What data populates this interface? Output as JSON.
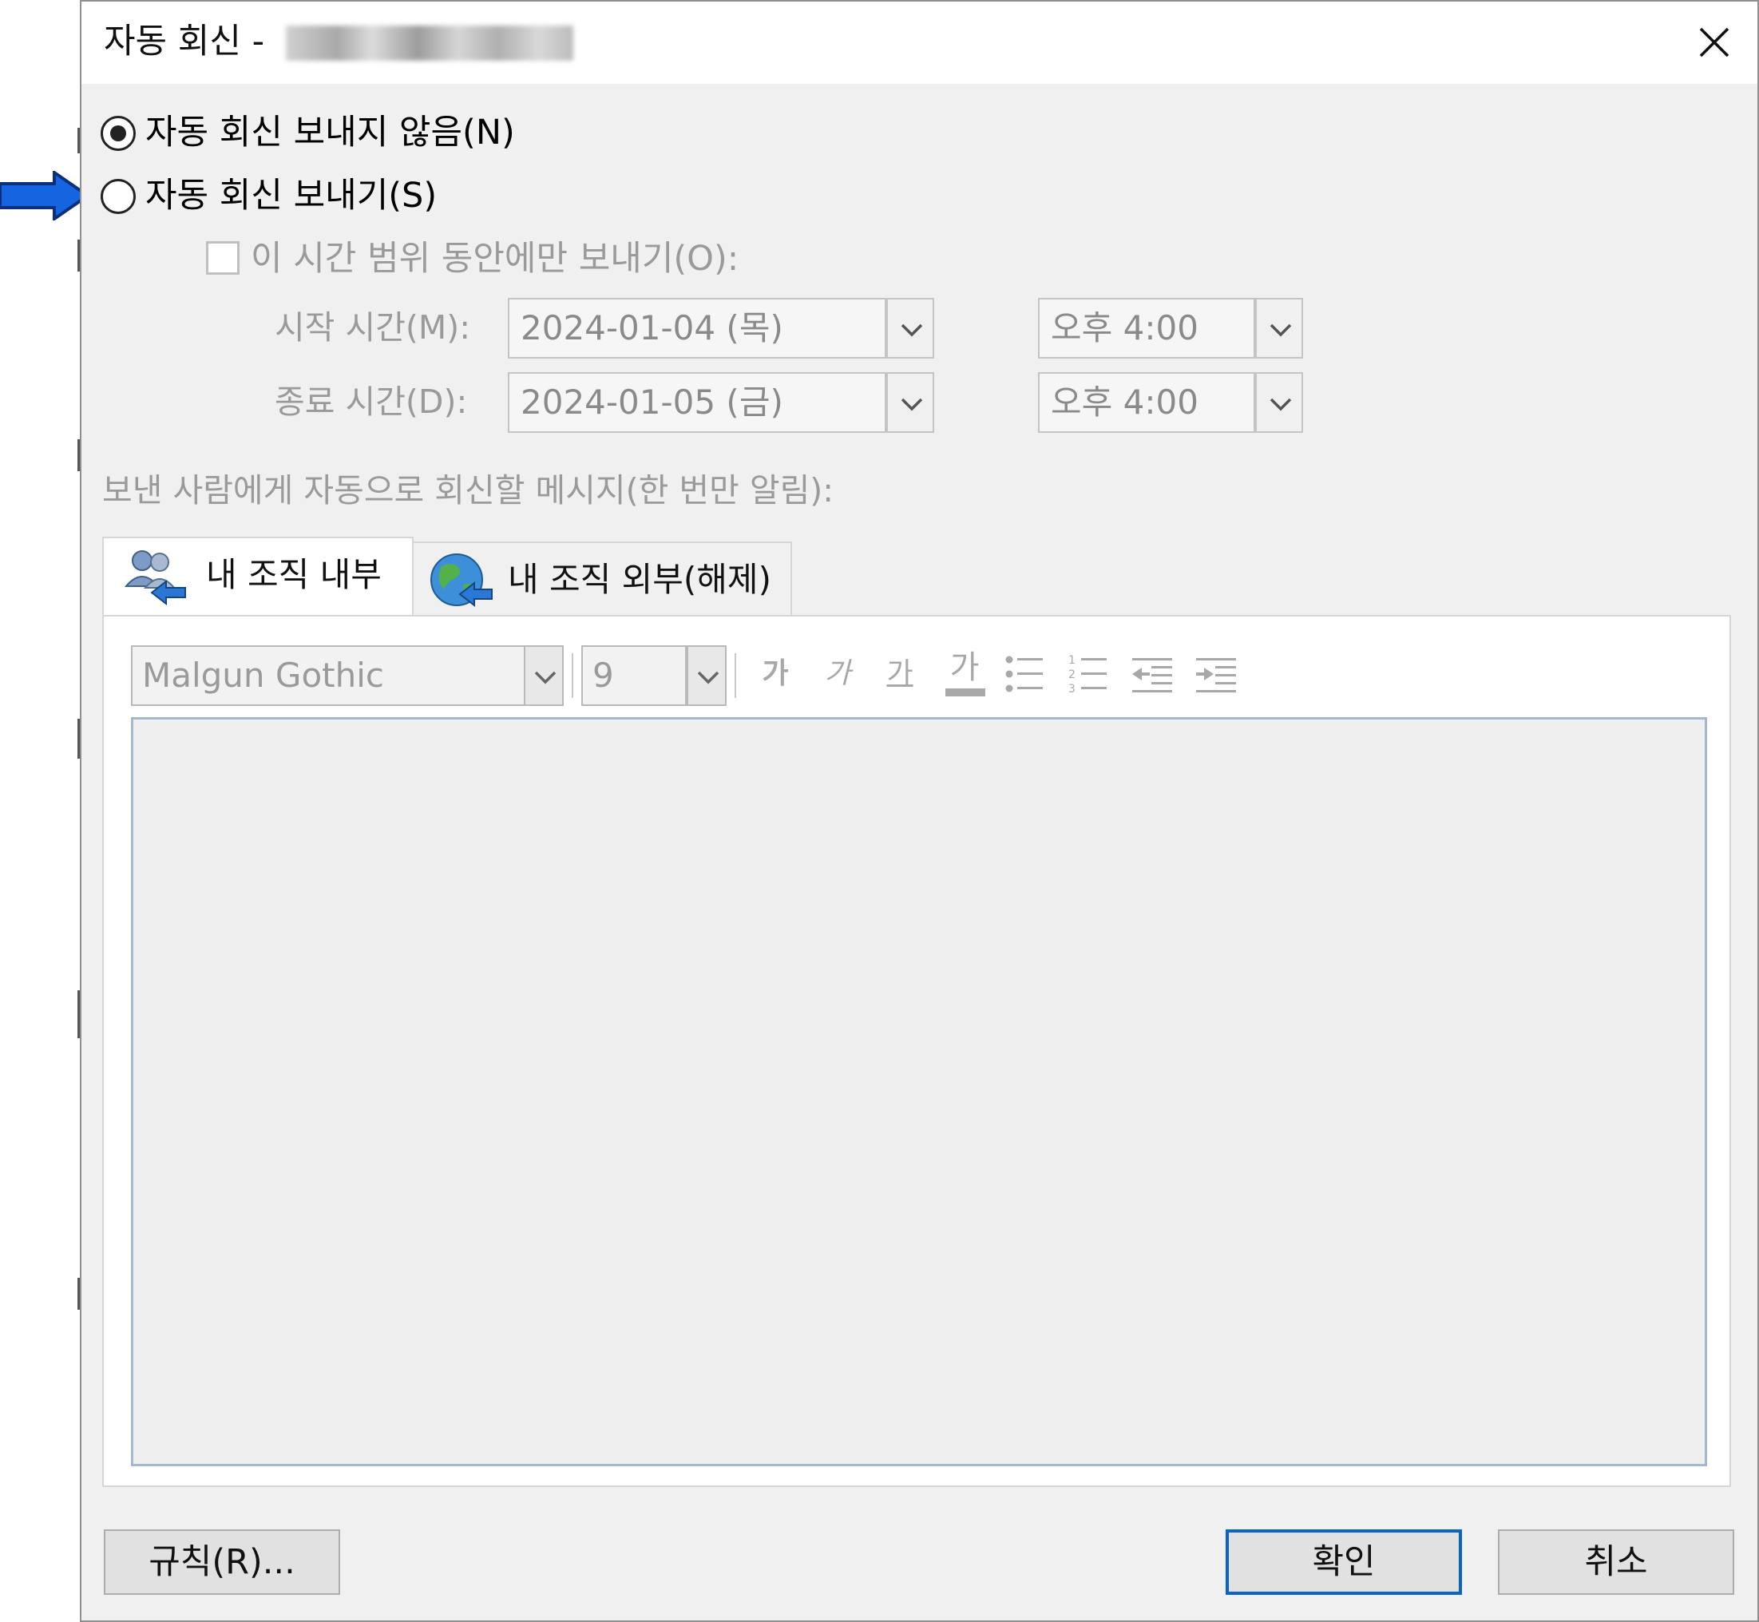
{
  "dialog": {
    "title": "자동 회신 -",
    "title_account_blurred": true
  },
  "options": {
    "no_auto_reply": {
      "label": "자동 회신 보내지 않음(N)",
      "selected": true
    },
    "send_auto_reply": {
      "label": "자동 회신 보내기(S)",
      "selected": false
    },
    "only_during_range": {
      "label": "이 시간 범위 동안에만 보내기(O):",
      "checked": false
    }
  },
  "schedule": {
    "start": {
      "label": "시작 시간(M):",
      "date": "2024-01-04 (목)",
      "time": "오후 4:00"
    },
    "end": {
      "label": "종료 시간(D):",
      "date": "2024-01-05 (금)",
      "time": "오후 4:00"
    }
  },
  "message_label": "보낸 사람에게 자동으로 회신할 메시지(한 번만 알림):",
  "tabs": [
    {
      "label": "내 조직 내부",
      "icon": "people-arrow-icon",
      "active": true
    },
    {
      "label": "내 조직 외부(해제)",
      "icon": "globe-arrow-icon",
      "active": false
    }
  ],
  "toolbar": {
    "font": "Malgun Gothic",
    "size": "9",
    "bold": "가",
    "italic": "가",
    "underline": "가",
    "font_color": "가",
    "icons": [
      "bold-icon",
      "italic-icon",
      "underline-icon",
      "font-color-icon",
      "bullet-list-icon",
      "numbered-list-icon",
      "decrease-indent-icon",
      "increase-indent-icon"
    ]
  },
  "message_body": "",
  "buttons": {
    "rules": "규칙(R)...",
    "ok": "확인",
    "cancel": "취소"
  },
  "colors": {
    "accent_blue": "#0a64c8",
    "annotation_arrow": "#1565e0",
    "dialog_bg": "#f0f0f0",
    "disabled_text": "#9a9a9a"
  }
}
